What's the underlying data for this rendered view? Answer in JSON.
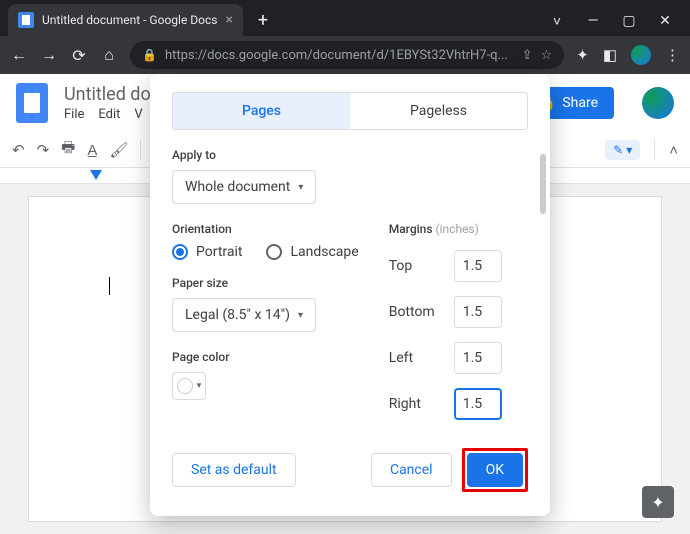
{
  "browser": {
    "tab_title": "Untitled document - Google Docs",
    "url": "https://docs.google.com/document/d/1EBYSt32VhtrH7-q..."
  },
  "app": {
    "doc_title": "Untitled document",
    "menus": {
      "file": "File",
      "edit": "Edit",
      "view": "V"
    },
    "share_label": "Share"
  },
  "dialog": {
    "tabs": {
      "pages": "Pages",
      "pageless": "Pageless"
    },
    "apply_to": {
      "label": "Apply to",
      "value": "Whole document"
    },
    "orientation": {
      "label": "Orientation",
      "portrait": "Portrait",
      "landscape": "Landscape"
    },
    "paper_size": {
      "label": "Paper size",
      "value": "Legal (8.5\" x 14\")"
    },
    "page_color": {
      "label": "Page color"
    },
    "margins": {
      "label": "Margins",
      "hint": "(inches)",
      "top_label": "Top",
      "top": "1.5",
      "bottom_label": "Bottom",
      "bottom": "1.5",
      "left_label": "Left",
      "left": "1.5",
      "right_label": "Right",
      "right": "1.5"
    },
    "actions": {
      "set_default": "Set as default",
      "cancel": "Cancel",
      "ok": "OK"
    }
  }
}
